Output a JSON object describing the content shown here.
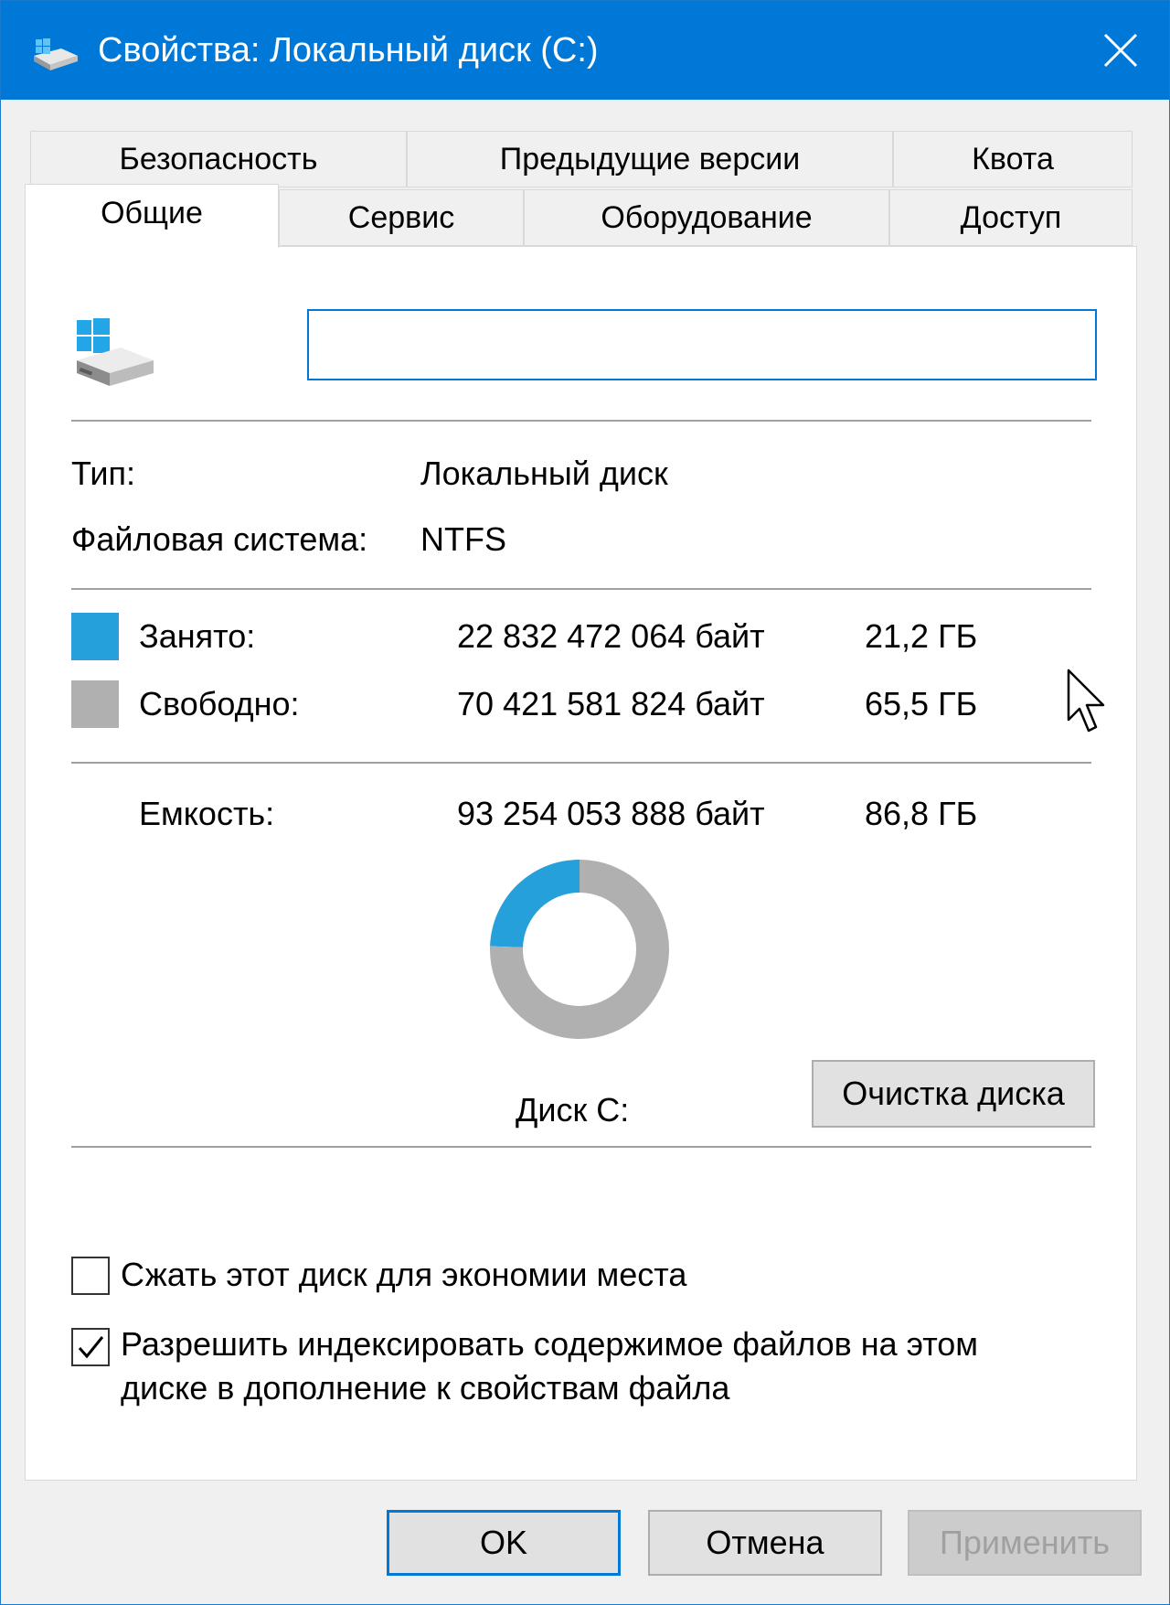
{
  "window": {
    "title": "Свойства: Локальный диск (C:)",
    "accent_color": "#0078d7"
  },
  "tabs": {
    "row1": [
      {
        "label": "Безопасность"
      },
      {
        "label": "Предыдущие версии"
      },
      {
        "label": "Квота"
      }
    ],
    "row2": [
      {
        "label": "Общие",
        "active": true
      },
      {
        "label": "Сервис"
      },
      {
        "label": "Оборудование"
      },
      {
        "label": "Доступ"
      }
    ]
  },
  "general": {
    "drive_icon": "drive-windows-icon",
    "volume_label_value": "",
    "type_label": "Тип:",
    "type_value": "Локальный диск",
    "fs_label": "Файловая система:",
    "fs_value": "NTFS",
    "used": {
      "label": "Занято:",
      "bytes": "22 832 472 064 байт",
      "size": "21,2 ГБ",
      "color": "#26a0da"
    },
    "free": {
      "label": "Свободно:",
      "bytes": "70 421 581 824 байт",
      "size": "65,5 ГБ",
      "color": "#b0b0b0"
    },
    "capacity": {
      "label": "Емкость:",
      "bytes": "93 254 053 888 байт",
      "size": "86,8 ГБ"
    },
    "disk_caption": "Диск C:",
    "cleanup_button": "Очистка диска",
    "compress_checkbox": {
      "label": "Сжать этот диск для экономии места",
      "checked": false
    },
    "index_checkbox": {
      "label_line1": "Разрешить индексировать содержимое файлов на этом",
      "label_line2": "диске в дополнение к свойствам файла",
      "checked": true
    }
  },
  "chart_data": {
    "type": "pie",
    "categories": [
      "Занято",
      "Свободно"
    ],
    "values": [
      21.2,
      65.5
    ],
    "colors": [
      "#26a0da",
      "#b0b0b0"
    ],
    "title": "Диск C:"
  },
  "footer": {
    "ok": "OK",
    "cancel": "Отмена",
    "apply": "Применить"
  }
}
